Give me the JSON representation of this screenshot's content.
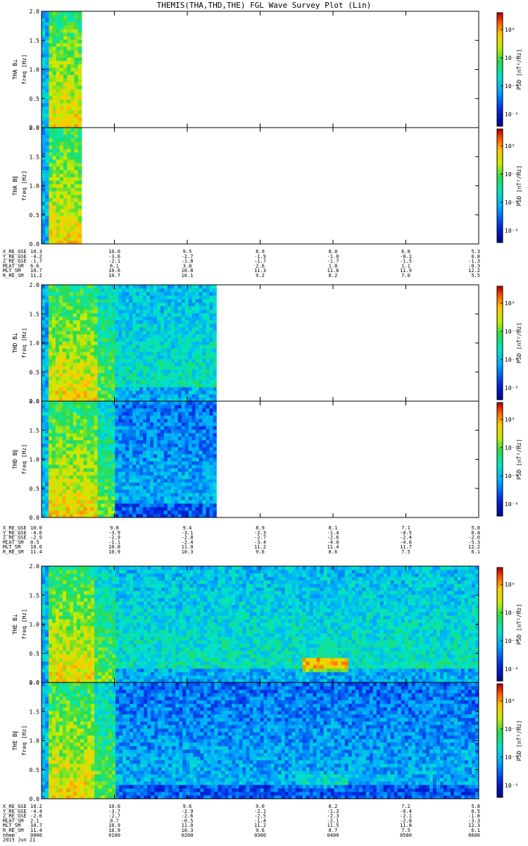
{
  "title": "THEMIS(THA,THD,THE) FGL Wave Survey Plot (Lin)",
  "chart_data": [
    {
      "type": "heatmap",
      "probe": "THA",
      "panels": [
        {
          "label": "THA B⊥",
          "ylabel": "freq [Hz]",
          "cbar_label": "PSD [nT²/Hz]"
        },
        {
          "label": "THA B∥",
          "ylabel": "freq [Hz]",
          "cbar_label": "PSD [nT²/Hz]"
        }
      ],
      "ylim": [
        0.0,
        2.0
      ],
      "yticks": [
        "0.0",
        "0.5",
        "1.0",
        "1.5",
        "2.0"
      ],
      "cbar_ticks": [
        "10⁰",
        "10⁻²",
        "10⁻⁴",
        "10⁻⁶"
      ],
      "data_end_hour": 0.55,
      "xlim_hours": [
        0,
        6
      ],
      "ephemeris": [
        {
          "name": "X_RE_GSE",
          "values": [
            "10.3",
            "10.0",
            "9.5",
            "8.9",
            "8.0",
            "6.8",
            "5.3"
          ]
        },
        {
          "name": "Y_RE_GSE",
          "values": [
            "-4.2",
            "-3.6",
            "-2.7",
            "-1.9",
            "-1.0",
            "-0.1",
            "0.8"
          ]
        },
        {
          "name": "Z_RE_GSE",
          "values": [
            "-1.7",
            "-2.1",
            "-1.8",
            "-1.7",
            "-1.7",
            "-1.5",
            "-1.3"
          ]
        },
        {
          "name": "MLAT_SM",
          "values": [
            "6.6",
            "6.1",
            "3.8",
            "2.6",
            "1.8",
            "1.1",
            "-0.3"
          ]
        },
        {
          "name": "MLT_SM",
          "values": [
            "10.7",
            "10.6",
            "10.8",
            "11.3",
            "11.6",
            "11.9",
            "12.2"
          ]
        },
        {
          "name": "R_RE_SM",
          "values": [
            "11.2",
            "10.7",
            "10.1",
            "9.2",
            "8.2",
            "7.0",
            "5.5"
          ]
        }
      ]
    },
    {
      "type": "heatmap",
      "probe": "THD",
      "panels": [
        {
          "label": "THD B⊥",
          "ylabel": "freq [Hz]",
          "cbar_label": "PSD [nT²/Hz]"
        },
        {
          "label": "THD B∥",
          "ylabel": "freq [Hz]",
          "cbar_label": "PSD [nT²/Hz]"
        }
      ],
      "ylim": [
        0.0,
        2.0
      ],
      "yticks": [
        "0.0",
        "0.5",
        "1.0",
        "1.5",
        "2.0"
      ],
      "cbar_ticks": [
        "10⁰",
        "10⁻²",
        "10⁻⁴",
        "10⁻⁶"
      ],
      "data_end_hour": 2.4,
      "xlim_hours": [
        0,
        6
      ],
      "ephemeris": [
        {
          "name": "X_RE_GSE",
          "values": [
            "10.0",
            "9.8",
            "9.4",
            "8.9",
            "8.1",
            "7.1",
            "5.8"
          ]
        },
        {
          "name": "Y_RE_GSE",
          "values": [
            "-4.6",
            "-3.9",
            "-3.1",
            "-2.3",
            "-1.4",
            "-0.5",
            "0.4"
          ]
        },
        {
          "name": "Z_RE_GSE",
          "values": [
            "-2.9",
            "-2.9",
            "-2.8",
            "-2.7",
            "-2.6",
            "-2.4",
            "-2.0"
          ]
        },
        {
          "name": "MLAT_SM",
          "values": [
            "0.5",
            "-1.1",
            "-2.4",
            "-3.4",
            "-4.0",
            "-4.6",
            "-5.3"
          ]
        },
        {
          "name": "MLT_SM",
          "values": [
            "10.6",
            "10.8",
            "11.0",
            "11.2",
            "11.4",
            "11.7",
            "12.2"
          ]
        },
        {
          "name": "R_RE_SM",
          "values": [
            "11.4",
            "10.9",
            "10.3",
            "9.6",
            "8.6",
            "7.5",
            "6.1"
          ]
        }
      ]
    },
    {
      "type": "heatmap",
      "probe": "THE",
      "panels": [
        {
          "label": "THE B⊥",
          "ylabel": "freq [Hz]",
          "cbar_label": "PSD [nT²/Hz]"
        },
        {
          "label": "THE B∥",
          "ylabel": "freq [Hz]",
          "cbar_label": "PSD [nT²/Hz]"
        }
      ],
      "ylim": [
        0.0,
        2.0
      ],
      "yticks": [
        "0.0",
        "0.5",
        "1.0",
        "1.5",
        "2.0"
      ],
      "cbar_ticks": [
        "10⁰",
        "10⁻²",
        "10⁻⁴",
        "10⁻⁶"
      ],
      "data_end_hour": 6.0,
      "xlim_hours": [
        0,
        6
      ],
      "ephemeris": [
        {
          "name": "X_RE_GSE",
          "values": [
            "10.2",
            "10.0",
            "9.6",
            "9.0",
            "8.2",
            "7.2",
            "5.8"
          ]
        },
        {
          "name": "Y_RE_GSE",
          "values": [
            "-4.4",
            "-3.7",
            "-2.9",
            "-2.1",
            "-1.3",
            "-0.4",
            "0.5"
          ]
        },
        {
          "name": "Z_RE_GSE",
          "values": [
            "-2.6",
            "-2.7",
            "-2.6",
            "-2.5",
            "-2.3",
            "-2.1",
            "-1.8"
          ]
        },
        {
          "name": "MLAT_SM",
          "values": [
            "2.1",
            "0.7",
            "-0.5",
            "-1.4",
            "-2.1",
            "-2.8",
            "-3.3"
          ]
        },
        {
          "name": "MLT_SM",
          "values": [
            "10.7",
            "10.9",
            "11.0",
            "11.2",
            "11.5",
            "11.8",
            "12.3"
          ]
        },
        {
          "name": "R_RE_SM",
          "values": [
            "11.4",
            "10.9",
            "10.3",
            "9.6",
            "8.7",
            "7.5",
            "6.1"
          ]
        }
      ],
      "time_axis": {
        "label": "hhmm",
        "date": "2015 Jun 21",
        "ticks": [
          "0000",
          "0100",
          "0200",
          "0300",
          "0400",
          "0500",
          "0600"
        ]
      }
    }
  ]
}
